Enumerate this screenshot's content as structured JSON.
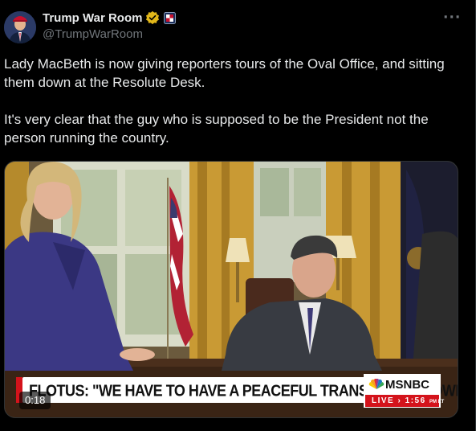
{
  "post": {
    "author": {
      "display_name": "Trump War Room",
      "handle": "@TrumpWarRoom",
      "verified_icon": "verified-gold-badge-icon",
      "affiliate_icon": "affiliate-badge-icon"
    },
    "more_icon": "more-horizontal-icon",
    "text": [
      "Lady MacBeth is now giving reporters tours of the Oval Office, and sitting them down at the Resolute Desk.",
      "It's very clear that the guy who is supposed to be the President not the person running the country."
    ]
  },
  "video": {
    "lower_third_headline": "FLOTUS: \"WE HAVE TO HAVE A PEACEFUL TRANSFER OF POWER\"",
    "network_logo": "MSNBC",
    "live_label": "LIVE",
    "live_time": "1:56",
    "live_time_suffix": "PM ET",
    "duration": "0:18"
  },
  "colors": {
    "background": "#000000",
    "text_primary": "#e7e9ea",
    "text_secondary": "#71767b",
    "verified_gold": "#e2b719",
    "msnbc_red": "#d4131b"
  }
}
